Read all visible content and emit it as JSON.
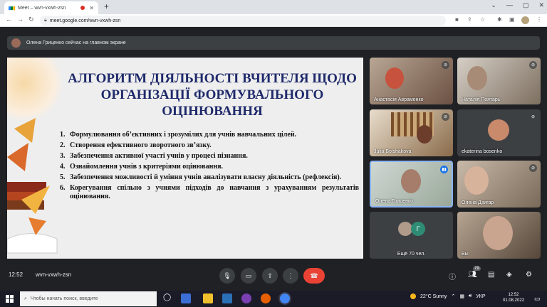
{
  "browser": {
    "tab_title": "Meet – wvn-vxwh-zsn",
    "url": "meet.google.com/wvn-vxwh-zsn"
  },
  "meet": {
    "presenting_text": "Олена Гриценко сейчас на главном экране",
    "time": "12:52",
    "meeting_code": "wvn-vxwh-zsn",
    "participants_badge": "79"
  },
  "slide": {
    "title": "АЛГОРИТМ ДІЯЛЬНОСТІ ВЧИТЕЛЯ ЩОДО ОРГАНІЗАЦІЇ ФОРМУВАЛЬНОГО ОЦІНЮВАННЯ",
    "items": [
      {
        "num": "1.",
        "text": "Формулювання об’єктивних і зрозумілих для учнів навчальних цілей."
      },
      {
        "num": "2.",
        "text": "Створення ефективного зворотного зв’язку."
      },
      {
        "num": "3.",
        "text": "Забезпечення активної участі учнів у процесі пізнання."
      },
      {
        "num": "4.",
        "text": "Ознайомлення учнів з критеріями оцінювання."
      },
      {
        "num": "5.",
        "text": "Забезпечення можливості й уміння учнів аналізувати власну діяльність (рефлексія)."
      },
      {
        "num": "6.",
        "text": "Корегування спільно з учнями підходів до навчання з урахуванням результатів оцінювання."
      }
    ]
  },
  "tiles": [
    {
      "name": "Анастасія Авраменко"
    },
    {
      "name": "Наталія Поятарь"
    },
    {
      "name": "Julia Bolshakova"
    },
    {
      "name": "ekaterina bosenko"
    },
    {
      "name": "Олена Гриценко"
    },
    {
      "name": "Олена Дзигар"
    },
    {
      "name": "Ещё 70 чел.",
      "avatar_letter": "Г"
    },
    {
      "name": "Вы"
    }
  ],
  "taskbar": {
    "search_placeholder": "Чтобы начать поиск, введите",
    "weather": "22°C  Sunny",
    "language": "УКР",
    "clock_time": "12:52",
    "clock_date": "01.08.2022"
  },
  "icons": [
    "meet-favicon",
    "record-indicator",
    "close-icon",
    "new-tab-icon",
    "back-icon",
    "forward-icon",
    "reload-icon",
    "lock-icon",
    "camera-icon",
    "share-icon",
    "star-icon",
    "extensions-icon",
    "reading-list-icon",
    "profile-avatar",
    "menu-icon",
    "mic-off-icon",
    "mic-on-icon",
    "mic-button",
    "camera-button",
    "present-button",
    "more-button",
    "hangup-button",
    "info-icon",
    "people-icon",
    "chat-icon",
    "activities-icon",
    "host-controls-icon",
    "windows-start-icon",
    "search-icon"
  ]
}
